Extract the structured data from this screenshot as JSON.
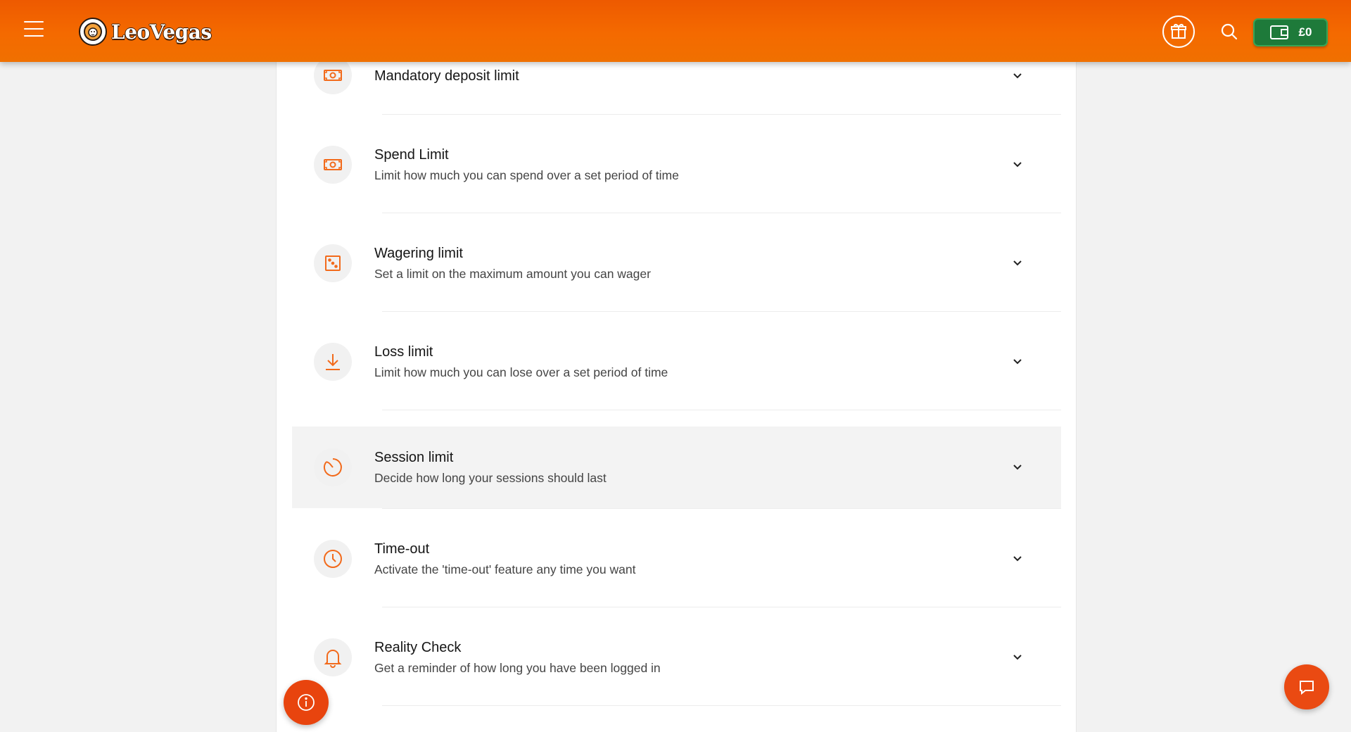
{
  "header": {
    "brand": "LeoVegas",
    "wallet_amount": "£0",
    "icons": [
      "menu-icon",
      "lion-logo-icon",
      "gift-icon",
      "search-icon",
      "wallet-icon"
    ]
  },
  "limits": [
    {
      "title": "Mandatory deposit limit",
      "subtitle": "",
      "icon": "money-icon"
    },
    {
      "title": "Spend Limit",
      "subtitle": "Limit how much you can spend over a set period of time",
      "icon": "money-icon"
    },
    {
      "title": "Wagering limit",
      "subtitle": "Set a limit on the maximum amount you can wager",
      "icon": "dice-icon"
    },
    {
      "title": "Loss limit",
      "subtitle": "Limit how much you can lose over a set period of time",
      "icon": "download-arrow-icon"
    },
    {
      "title": "Session limit",
      "subtitle": "Decide how long your sessions should last",
      "icon": "timer-icon"
    },
    {
      "title": "Time-out",
      "subtitle": "Activate the 'time-out' feature any time you want",
      "icon": "clock-icon"
    },
    {
      "title": "Reality Check",
      "subtitle": "Get a reminder of how long you have been logged in",
      "icon": "bell-icon"
    }
  ],
  "floating": {
    "info_icon": "info-icon",
    "chat_icon": "chat-icon"
  },
  "colors": {
    "brand_orange": "#f46a00",
    "accent": "#e8440e",
    "wallet_green": "#1e7a3a",
    "icon_orange": "#f26a1b"
  }
}
